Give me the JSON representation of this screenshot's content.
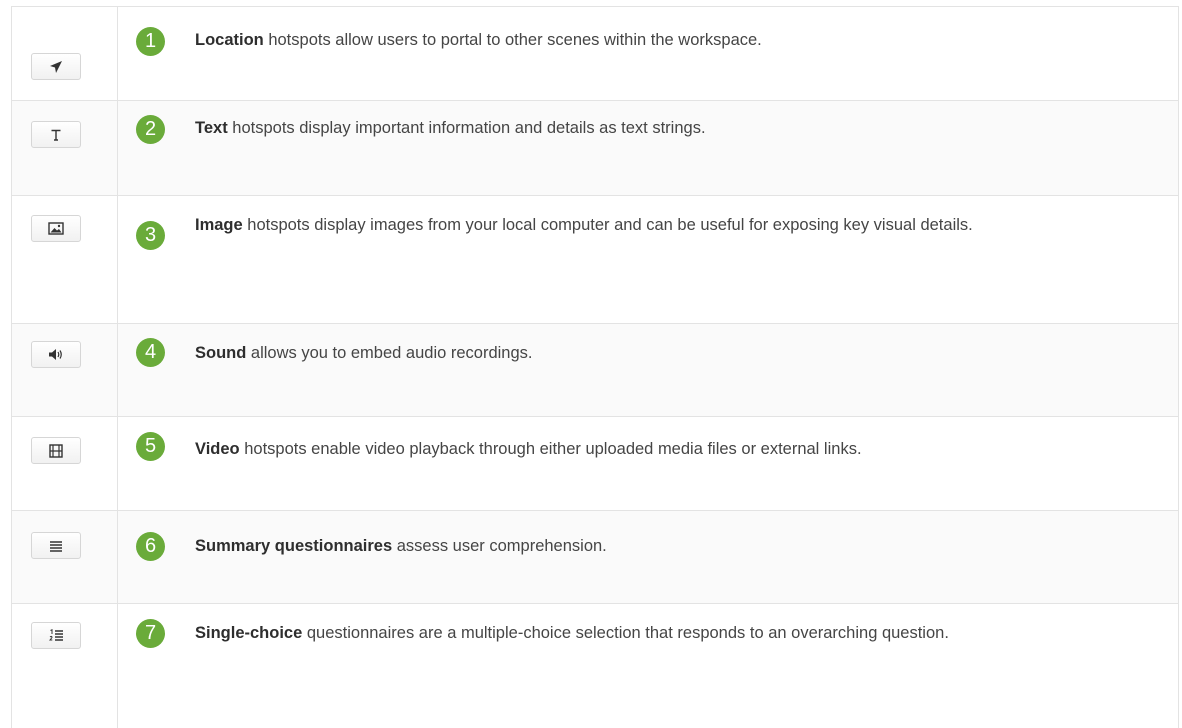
{
  "rows": [
    {
      "number": "1",
      "title": "Location",
      "description": " hotspots allow users to portal to other scenes within the workspace.",
      "icon": "location-arrow-icon"
    },
    {
      "number": "2",
      "title": "Text",
      "description": " hotspots display important information and details as text strings.",
      "icon": "text-icon"
    },
    {
      "number": "3",
      "title": "Image",
      "description": " hotspots display images from your local computer and can be useful for exposing key visual details.",
      "icon": "image-icon"
    },
    {
      "number": "4",
      "title": "Sound",
      "description": " allows you to embed audio recordings.",
      "icon": "volume-icon"
    },
    {
      "number": "5",
      "title": "Video",
      "description": " hotspots enable video playback through either uploaded media files or external links.",
      "icon": "film-icon"
    },
    {
      "number": "6",
      "title": "Summary questionnaires",
      "description": " assess user comprehension.",
      "icon": "list-icon"
    },
    {
      "number": "7",
      "title": "Single-choice",
      "description": " questionnaires are a multiple-choice selection that responds to an overarching question.",
      "icon": "ordered-list-icon"
    }
  ],
  "colors": {
    "badge": "#6aab3a",
    "border": "#e3e3e3"
  }
}
